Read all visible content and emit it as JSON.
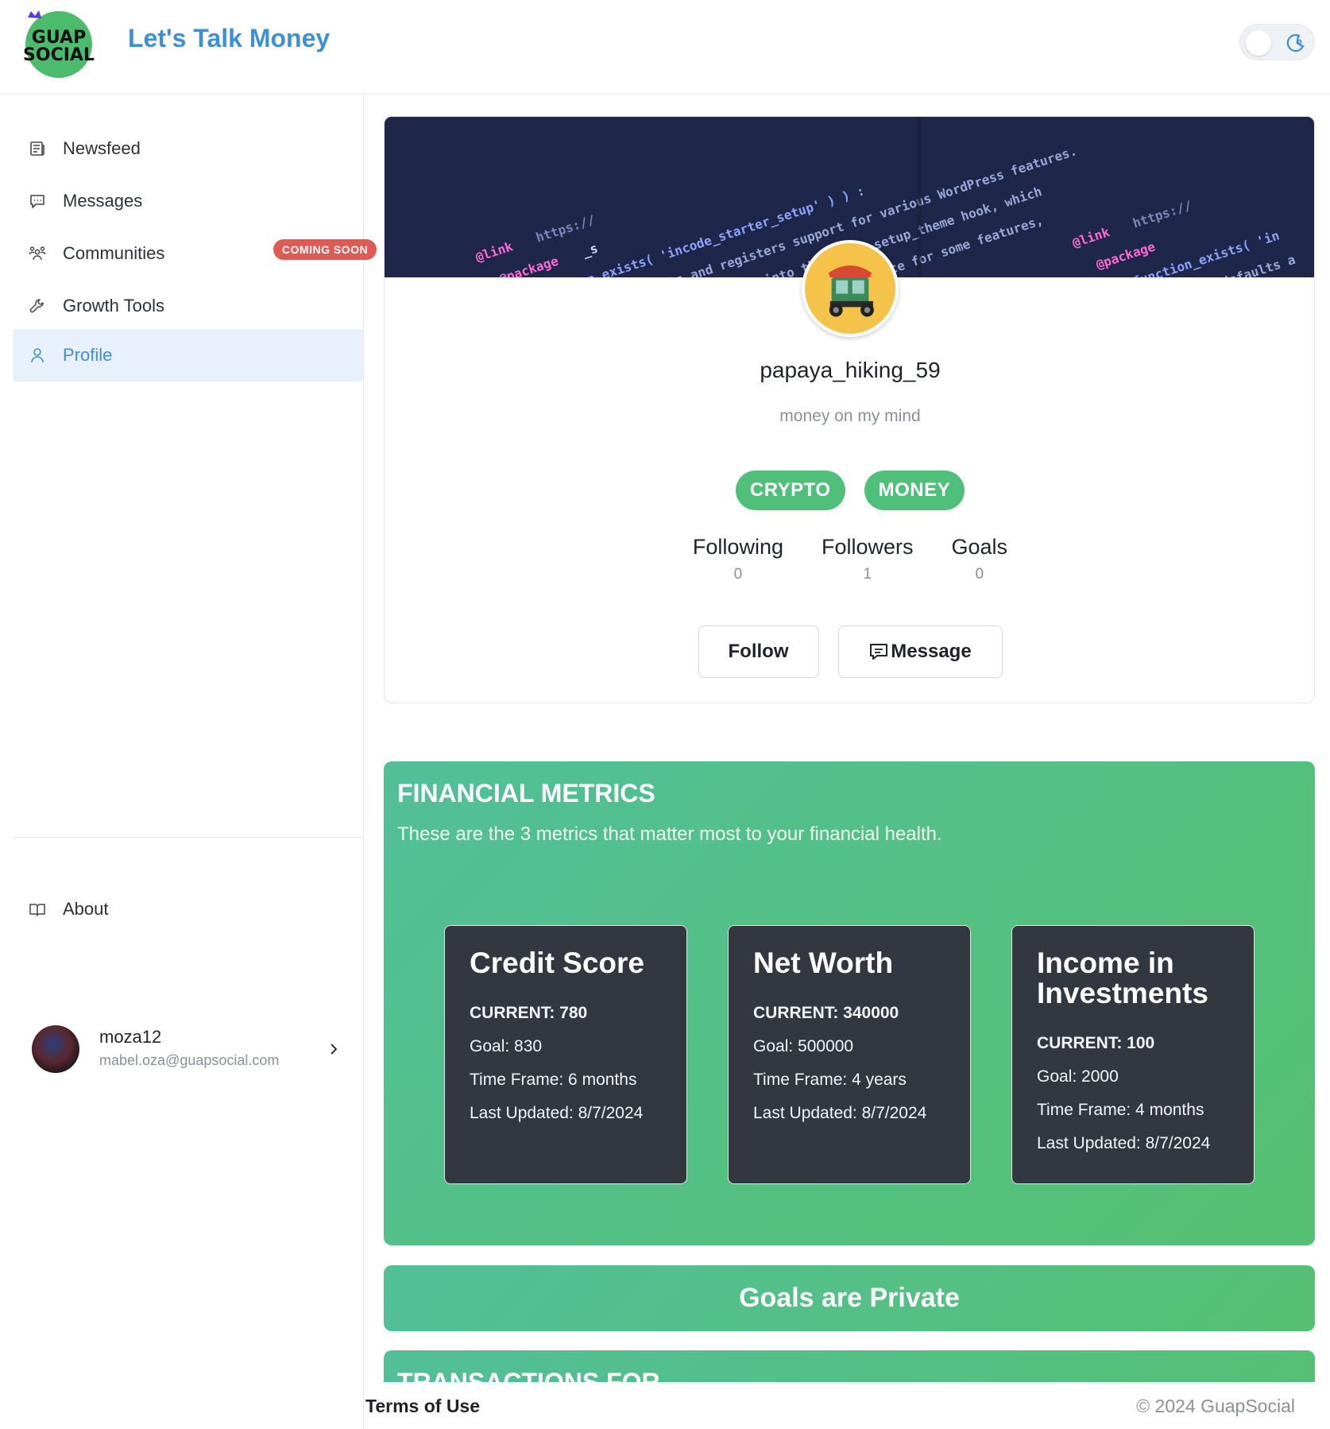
{
  "header": {
    "logo_text": "GUAP SOCIAL",
    "title": "Let's Talk Money",
    "theme_toggle_icon": "moon-icon"
  },
  "sidebar": {
    "items": [
      {
        "label": "Newsfeed",
        "icon": "newspaper-icon"
      },
      {
        "label": "Messages",
        "icon": "chat-icon"
      },
      {
        "label": "Communities",
        "icon": "people-icon",
        "badge": "COMING SOON"
      },
      {
        "label": "Growth Tools",
        "icon": "wrench-icon"
      },
      {
        "label": "Profile",
        "icon": "user-icon",
        "active": true
      }
    ],
    "about": {
      "label": "About",
      "icon": "book-icon"
    },
    "user": {
      "name": "moza12",
      "email": "mabel.oza@guapsocial.com"
    }
  },
  "profile": {
    "username": "papaya_hiking_59",
    "bio": "money on my mind",
    "tags": [
      "CRYPTO",
      "MONEY"
    ],
    "stats": [
      {
        "label": "Following",
        "value": "0"
      },
      {
        "label": "Followers",
        "value": "1"
      },
      {
        "label": "Goals",
        "value": "0"
      }
    ],
    "follow_label": "Follow",
    "message_label": "Message"
  },
  "metrics": {
    "title": "FINANCIAL METRICS",
    "subtitle": "These are the 3 metrics that matter most to your financial health.",
    "cards": [
      {
        "title": "Credit Score",
        "current": "CURRENT: 780",
        "goal": "Goal: 830",
        "timeframe": "Time Frame: 6 months",
        "updated": "Last Updated: 8/7/2024"
      },
      {
        "title": "Net Worth",
        "current": "CURRENT: 340000",
        "goal": "Goal: 500000",
        "timeframe": "Time Frame: 4 years",
        "updated": "Last Updated: 8/7/2024"
      },
      {
        "title": "Income in Investments",
        "current": "CURRENT: 100",
        "goal": "Goal: 2000",
        "timeframe": "Time Frame: 4 months",
        "updated": "Last Updated: 8/7/2024"
      }
    ]
  },
  "goals_private": "Goals are Private",
  "transactions_title": "TRANSACTIONS FOR",
  "footer": {
    "terms": "Terms of Use",
    "copyright": "© 2024 GuapSocial"
  },
  "colors": {
    "accent": "#3d8fd6",
    "green": "#4fbf7a",
    "badge": "#e05a55",
    "card": "#333840"
  }
}
